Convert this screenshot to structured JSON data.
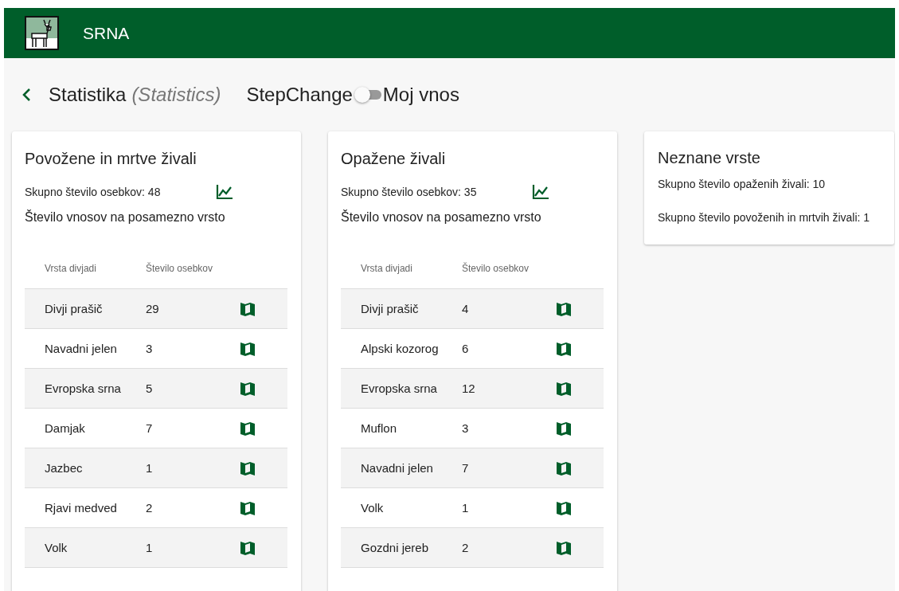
{
  "app_bar": {
    "title": "SRNA"
  },
  "header": {
    "title": "Statistika",
    "subtitle": "(Statistics)",
    "toggle": {
      "label_left": "StepChange",
      "label_right": "Moj vnos",
      "on": false
    }
  },
  "cards": [
    {
      "title": "Povožene in mrtve živali",
      "total": "Skupno število osebkov: 48",
      "subtitle": "Število vnosov na posamezno vrsto",
      "columns": [
        "Vrsta divjadi",
        "Število osebkov"
      ],
      "rows": [
        {
          "species": "Divji prašič",
          "count": "29"
        },
        {
          "species": "Navadni jelen",
          "count": "3"
        },
        {
          "species": "Evropska srna",
          "count": "5"
        },
        {
          "species": "Damjak",
          "count": "7"
        },
        {
          "species": "Jazbec",
          "count": "1"
        },
        {
          "species": "Rjavi medved",
          "count": "2"
        },
        {
          "species": "Volk",
          "count": "1"
        }
      ]
    },
    {
      "title": "Opažene živali",
      "total": "Skupno število osebkov: 35",
      "subtitle": "Število vnosov na posamezno vrsto",
      "columns": [
        "Vrsta divjadi",
        "Število osebkov"
      ],
      "rows": [
        {
          "species": "Divji prašič",
          "count": "4"
        },
        {
          "species": "Alpski kozorog",
          "count": "6"
        },
        {
          "species": "Evropska srna",
          "count": "12"
        },
        {
          "species": "Muflon",
          "count": "3"
        },
        {
          "species": "Navadni jelen",
          "count": "7"
        },
        {
          "species": "Volk",
          "count": "1"
        },
        {
          "species": "Gozdni jereb",
          "count": "2"
        }
      ]
    }
  ],
  "unknown": {
    "title": "Neznane vrste",
    "lines": [
      "Skupno število opaženih živali: 10",
      "Skupno število povoženih in mrtvih živali: 1"
    ]
  }
}
